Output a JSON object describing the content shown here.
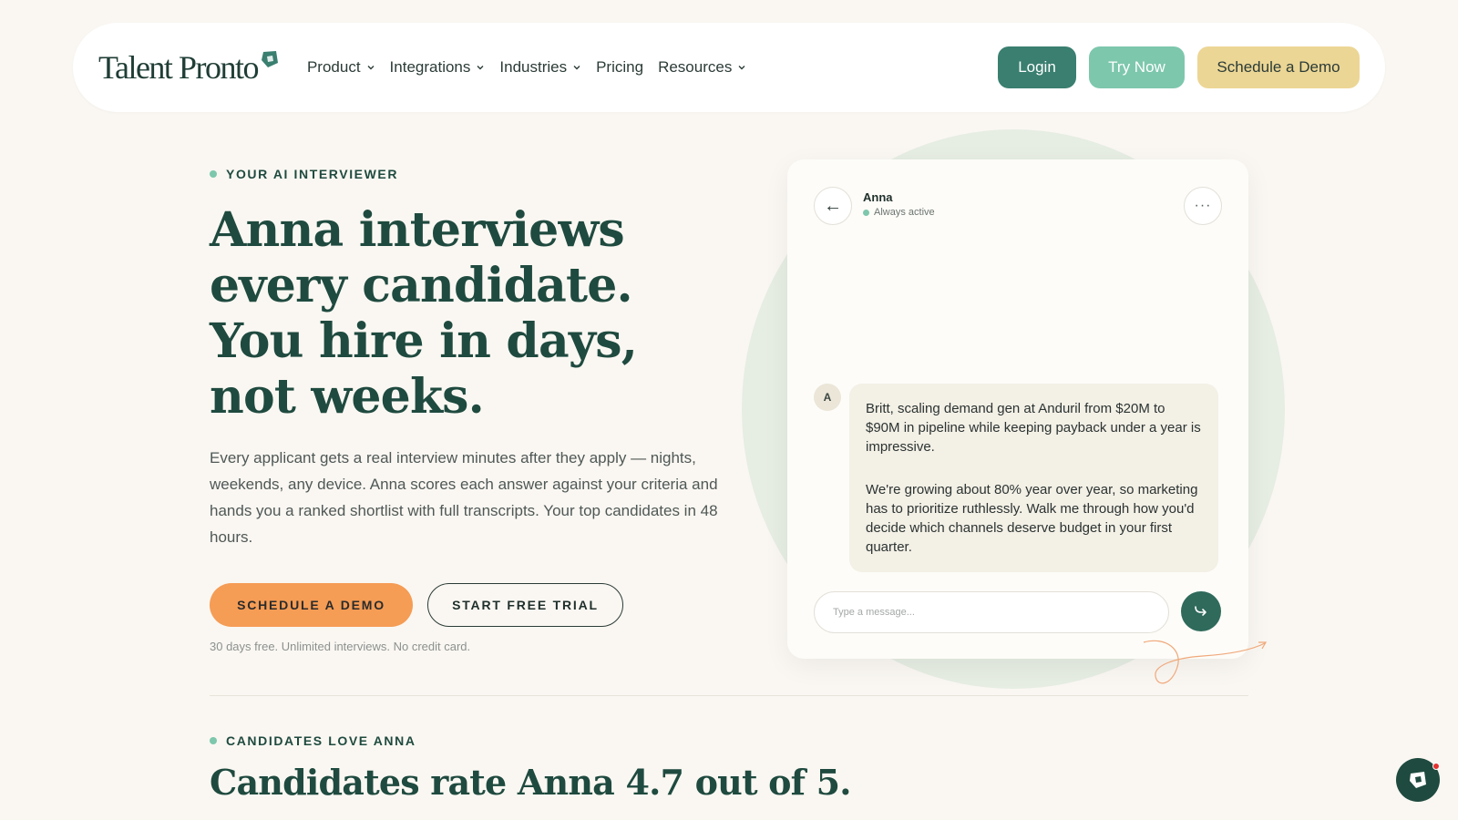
{
  "nav": {
    "logo_text": "Talent Pronto",
    "menu": [
      {
        "label": "Product",
        "has_dropdown": true
      },
      {
        "label": "Integrations",
        "has_dropdown": true
      },
      {
        "label": "Industries",
        "has_dropdown": true
      },
      {
        "label": "Pricing",
        "has_dropdown": false
      },
      {
        "label": "Resources",
        "has_dropdown": true
      }
    ],
    "login_label": "Login",
    "try_label": "Try Now",
    "demo_label": "Schedule a Demo"
  },
  "hero": {
    "eyebrow": "YOUR AI INTERVIEWER",
    "title": "Anna interviews every candidate. You hire in days, not weeks.",
    "description": "Every applicant gets a real interview minutes after they apply — nights, weekends, any device. Anna scores each answer against your criteria and hands you a ranked shortlist with full transcripts. Your top candidates in 48 hours.",
    "primary_cta": "SCHEDULE A DEMO",
    "secondary_cta": "START FREE TRIAL",
    "fineprint": "30 days free. Unlimited interviews. No credit card."
  },
  "chat": {
    "name": "Anna",
    "status": "Always active",
    "avatar_initial": "A",
    "messages": [
      "Britt, scaling demand gen at Anduril from $20M to $90M in pipeline while keeping payback under a year is impressive.",
      "We're growing about 80% year over year, so marketing has to prioritize ruthlessly. Walk me through how you'd decide which channels deserve budget in your first quarter."
    ],
    "input_placeholder": "Type a message...",
    "back_icon": "arrow-left-icon",
    "more_icon": "more-dots-icon",
    "send_icon": "send-arrow-icon"
  },
  "reviews": {
    "eyebrow": "CANDIDATES LOVE ANNA",
    "title": "Candidates rate Anna 4.7 out of 5."
  },
  "colors": {
    "primary_green": "#3a7f70",
    "mint": "#7dc7ad",
    "gold": "#ecd695",
    "orange": "#f59c55",
    "heading": "#1f4a3f",
    "background": "#faf7f2"
  }
}
